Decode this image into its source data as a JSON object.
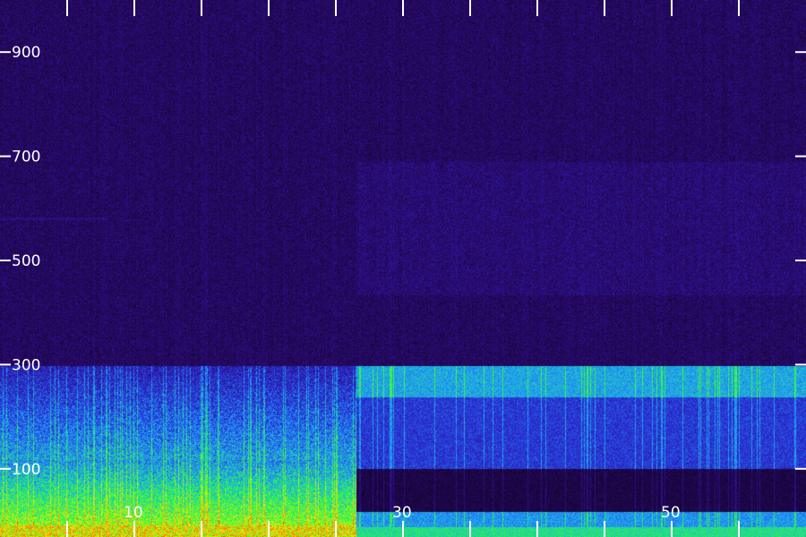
{
  "chart_data": {
    "type": "heatmap",
    "title": "",
    "xlabel": "",
    "ylabel": "",
    "x_unit_hint": "time",
    "y_unit_hint": "frequency",
    "xlim": [
      0,
      60
    ],
    "ylim": [
      0,
      1000
    ],
    "x_ticks_major": [
      0,
      5,
      10,
      15,
      20,
      25,
      30,
      35,
      40,
      45,
      50,
      55
    ],
    "x_tick_labels": [
      {
        "value": 10,
        "label": "10"
      },
      {
        "value": 30,
        "label": "30"
      },
      {
        "value": 50,
        "label": "50"
      }
    ],
    "y_tick_labels": [
      {
        "value": 100,
        "label": "100"
      },
      {
        "value": 300,
        "label": "300"
      },
      {
        "value": 500,
        "label": "500"
      },
      {
        "value": 700,
        "label": "700"
      },
      {
        "value": 900,
        "label": "900"
      }
    ],
    "segments": [
      {
        "x_start": 0,
        "x_end": 26.5,
        "band_top": 298,
        "bright_band": [
          0,
          140
        ],
        "bright_color": "#3cff30"
      },
      {
        "x_start": 26.5,
        "x_end": 60,
        "band_top": 298,
        "bright_band": [
          180,
          300
        ],
        "bright_color": "#19c8ff"
      }
    ],
    "faint_line_hz": 580,
    "colormap": [
      "#000000",
      "#1a0640",
      "#2c0c7a",
      "#2a2ad0",
      "#1ea0ff",
      "#2cff3c",
      "#ffe400",
      "#ff3000"
    ],
    "grid": false,
    "legend": "none"
  }
}
